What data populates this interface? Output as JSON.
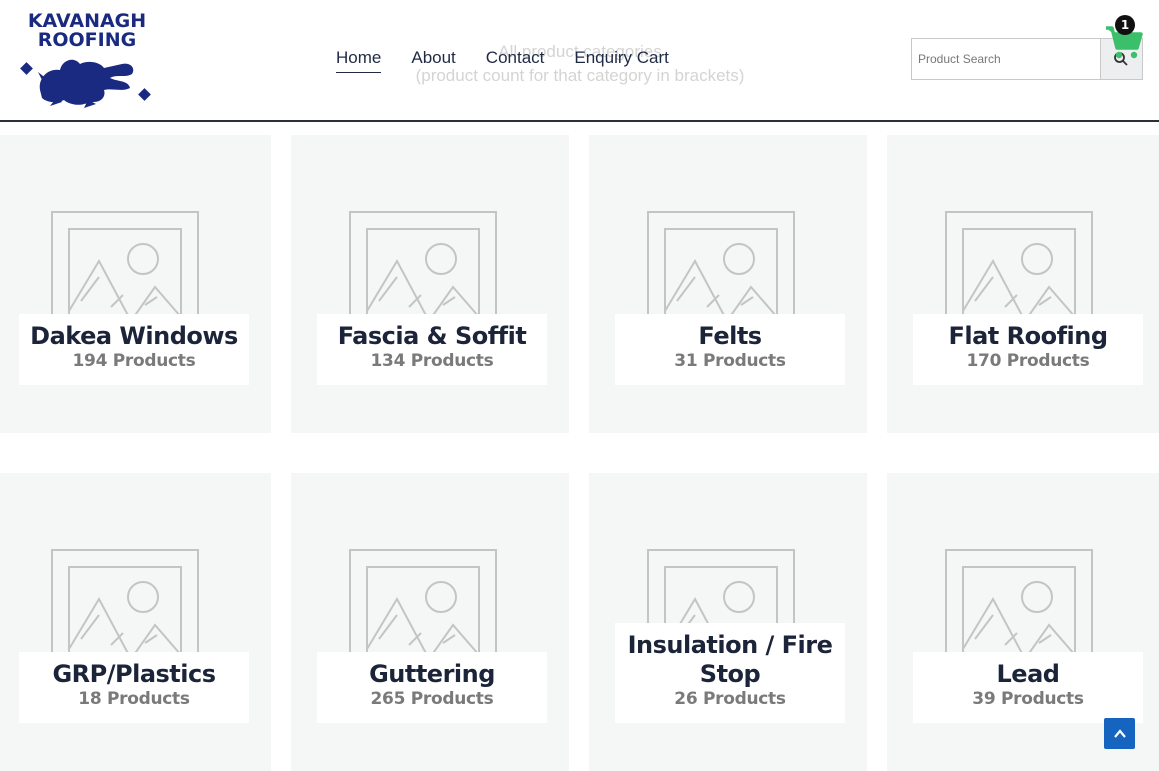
{
  "brand": {
    "line1": "KAVANAGH",
    "line2": "ROOFING"
  },
  "ghost_text": {
    "line1": "All product categories",
    "line2": "(product count for that category in brackets)"
  },
  "nav": [
    {
      "label": "Home",
      "active": true
    },
    {
      "label": "About",
      "active": false
    },
    {
      "label": "Contact",
      "active": false
    },
    {
      "label": "Enquiry Cart",
      "active": false
    }
  ],
  "search": {
    "placeholder": "Product Search",
    "icon": "search-icon"
  },
  "cart": {
    "count": "1",
    "icon": "cart-icon",
    "color": "#3bbf6a"
  },
  "categories": [
    {
      "name": "Dakea Windows",
      "count": "194 Products"
    },
    {
      "name": "Fascia & Soffit",
      "count": "134 Products"
    },
    {
      "name": "Felts",
      "count": "31 Products"
    },
    {
      "name": "Flat Roofing",
      "count": "170 Products"
    },
    {
      "name": "GRP/Plastics",
      "count": "18 Products"
    },
    {
      "name": "Guttering",
      "count": "265 Products"
    },
    {
      "name": "Insulation / Fire Stop",
      "count": "26 Products"
    },
    {
      "name": "Lead",
      "count": "39 Products"
    }
  ],
  "colors": {
    "brand_navy": "#1a2a80",
    "text_dark": "#1b2438",
    "card_bg": "#f5f6f6",
    "scroll_top": "#1565c0"
  }
}
